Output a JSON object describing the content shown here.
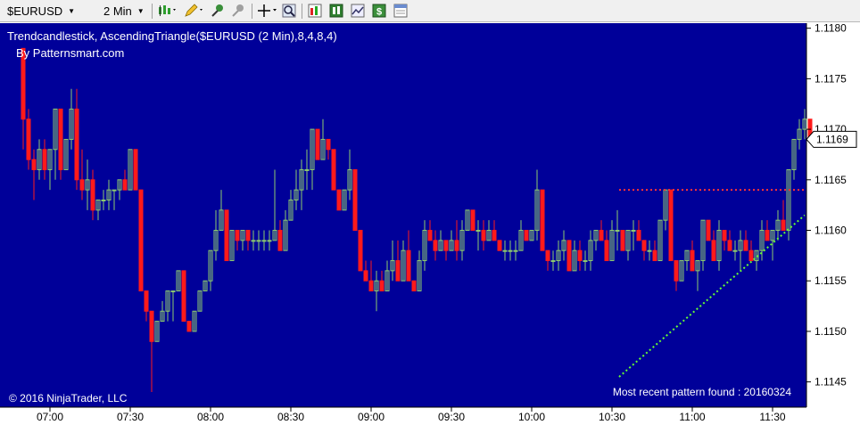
{
  "toolbar": {
    "instrument": "$EURUSD",
    "interval": "2 Min",
    "icons": [
      "chart-style-icon",
      "draw-pencil-icon",
      "pin-icon",
      "pin-gray-icon",
      "crosshair-icon",
      "zoom-icon",
      "indicators-icon",
      "strategies-icon",
      "chart-properties-icon",
      "dollar-icon",
      "data-box-icon"
    ]
  },
  "chart": {
    "indicator_label": "Trendcandlestick,  AscendingTriangle($EURUSD (2 Min),8,4,8,4)",
    "source_label": "By Patternsmart.com",
    "copyright": "© 2016 NinjaTrader, LLC",
    "pattern_status": "Most recent pattern found : 20160324",
    "last_price_label": "1.1169",
    "colors": {
      "background": "#000099",
      "up": "#8ecb6e",
      "down": "#ff1a1a",
      "resistance": "#ff3333",
      "support": "#66ff33"
    }
  },
  "chart_data": {
    "type": "candlestick",
    "x_tick_labels": [
      "07:00",
      "07:30",
      "08:00",
      "08:30",
      "09:00",
      "09:30",
      "10:00",
      "10:30",
      "11:00",
      "11:30"
    ],
    "y_tick_labels": [
      "1.1180",
      "1.1175",
      "1.1170",
      "1.1165",
      "1.1160",
      "1.1155",
      "1.1150",
      "1.1145"
    ],
    "ylim": [
      1.11425,
      1.11805
    ],
    "last_price": 1.1169,
    "resistance_level": 1.1164,
    "support_line": {
      "from": [
        98,
        1.11455
      ],
      "to": [
        146,
        1.11615
      ]
    },
    "candles": [
      [
        1.1178,
        1.1178,
        1.1168,
        1.1171
      ],
      [
        1.1171,
        1.1172,
        1.1166,
        1.1167
      ],
      [
        1.1167,
        1.1168,
        1.1163,
        1.1166
      ],
      [
        1.1166,
        1.1169,
        1.1165,
        1.1168
      ],
      [
        1.1168,
        1.1169,
        1.1165,
        1.1166
      ],
      [
        1.1166,
        1.1168,
        1.1164,
        1.1168
      ],
      [
        1.1168,
        1.1172,
        1.1165,
        1.1172
      ],
      [
        1.1172,
        1.1172,
        1.1165,
        1.1166
      ],
      [
        1.1166,
        1.1169,
        1.1166,
        1.1169
      ],
      [
        1.1169,
        1.1174,
        1.1168,
        1.1172
      ],
      [
        1.1172,
        1.1174,
        1.1164,
        1.1165
      ],
      [
        1.1165,
        1.1168,
        1.1163,
        1.1164
      ],
      [
        1.1164,
        1.1167,
        1.1162,
        1.1165
      ],
      [
        1.1165,
        1.1166,
        1.1161,
        1.1162
      ],
      [
        1.1162,
        1.1163,
        1.1161,
        1.1163
      ],
      [
        1.1163,
        1.1164,
        1.1162,
        1.1163
      ],
      [
        1.1163,
        1.1165,
        1.1162,
        1.1164
      ],
      [
        1.1164,
        1.1164,
        1.1162,
        1.1164
      ],
      [
        1.1164,
        1.1165,
        1.1163,
        1.1165
      ],
      [
        1.1165,
        1.1166,
        1.1164,
        1.1164
      ],
      [
        1.1164,
        1.1168,
        1.1164,
        1.1168
      ],
      [
        1.1168,
        1.1168,
        1.1164,
        1.1164
      ],
      [
        1.1164,
        1.1164,
        1.1155,
        1.1154
      ],
      [
        1.1154,
        1.1154,
        1.1151,
        1.1152
      ],
      [
        1.1152,
        1.1152,
        1.1144,
        1.1149
      ],
      [
        1.1149,
        1.1151,
        1.1149,
        1.1151
      ],
      [
        1.1151,
        1.1153,
        1.1151,
        1.1152
      ],
      [
        1.1152,
        1.1154,
        1.1151,
        1.1154
      ],
      [
        1.1154,
        1.1154,
        1.1151,
        1.1154
      ],
      [
        1.1154,
        1.1156,
        1.1154,
        1.1156
      ],
      [
        1.1156,
        1.1156,
        1.1151,
        1.1151
      ],
      [
        1.1151,
        1.1151,
        1.115,
        1.115
      ],
      [
        1.115,
        1.1152,
        1.115,
        1.1152
      ],
      [
        1.1152,
        1.1154,
        1.1152,
        1.1154
      ],
      [
        1.1154,
        1.1155,
        1.1154,
        1.1155
      ],
      [
        1.1155,
        1.1158,
        1.1154,
        1.1158
      ],
      [
        1.1158,
        1.1162,
        1.1157,
        1.116
      ],
      [
        1.116,
        1.1164,
        1.116,
        1.1162
      ],
      [
        1.1162,
        1.1162,
        1.1157,
        1.1157
      ],
      [
        1.1157,
        1.116,
        1.1157,
        1.116
      ],
      [
        1.116,
        1.116,
        1.1158,
        1.1159
      ],
      [
        1.1159,
        1.116,
        1.1158,
        1.116
      ],
      [
        1.116,
        1.116,
        1.1158,
        1.1159
      ],
      [
        1.1159,
        1.116,
        1.1158,
        1.1159
      ],
      [
        1.1159,
        1.116,
        1.1158,
        1.1159
      ],
      [
        1.1159,
        1.116,
        1.1158,
        1.1159
      ],
      [
        1.1159,
        1.116,
        1.1158,
        1.1159
      ],
      [
        1.1159,
        1.1166,
        1.1159,
        1.116
      ],
      [
        1.116,
        1.1161,
        1.1158,
        1.1158
      ],
      [
        1.1158,
        1.1162,
        1.1158,
        1.1161
      ],
      [
        1.1161,
        1.1164,
        1.1161,
        1.1163
      ],
      [
        1.1163,
        1.1166,
        1.1162,
        1.1164
      ],
      [
        1.1164,
        1.1167,
        1.1162,
        1.1166
      ],
      [
        1.1166,
        1.1168,
        1.1164,
        1.1166
      ],
      [
        1.1166,
        1.117,
        1.1164,
        1.117
      ],
      [
        1.117,
        1.117,
        1.1167,
        1.1167
      ],
      [
        1.1167,
        1.1171,
        1.1167,
        1.1169
      ],
      [
        1.1169,
        1.1169,
        1.1167,
        1.1168
      ],
      [
        1.1168,
        1.1168,
        1.1164,
        1.1164
      ],
      [
        1.1164,
        1.1164,
        1.1162,
        1.1162
      ],
      [
        1.1162,
        1.1164,
        1.1162,
        1.1164
      ],
      [
        1.1164,
        1.1168,
        1.1163,
        1.1166
      ],
      [
        1.1166,
        1.1166,
        1.116,
        1.116
      ],
      [
        1.116,
        1.116,
        1.1156,
        1.1156
      ],
      [
        1.1156,
        1.1157,
        1.1155,
        1.1155
      ],
      [
        1.1155,
        1.1157,
        1.1154,
        1.1154
      ],
      [
        1.1154,
        1.1156,
        1.1152,
        1.1155
      ],
      [
        1.1155,
        1.1156,
        1.1154,
        1.1154
      ],
      [
        1.1154,
        1.1157,
        1.1154,
        1.1156
      ],
      [
        1.1156,
        1.1159,
        1.1155,
        1.1157
      ],
      [
        1.1157,
        1.1159,
        1.1155,
        1.1155
      ],
      [
        1.1155,
        1.1159,
        1.1155,
        1.1158
      ],
      [
        1.1158,
        1.116,
        1.1155,
        1.1155
      ],
      [
        1.1155,
        1.1155,
        1.1154,
        1.1154
      ],
      [
        1.1154,
        1.1158,
        1.1154,
        1.1157
      ],
      [
        1.1157,
        1.1161,
        1.1156,
        1.116
      ],
      [
        1.116,
        1.1161,
        1.1159,
        1.1159
      ],
      [
        1.1159,
        1.116,
        1.1157,
        1.1158
      ],
      [
        1.1158,
        1.116,
        1.1158,
        1.1159
      ],
      [
        1.1159,
        1.1159,
        1.1157,
        1.1158
      ],
      [
        1.1158,
        1.116,
        1.1158,
        1.1159
      ],
      [
        1.1159,
        1.1161,
        1.1157,
        1.1158
      ],
      [
        1.1158,
        1.1161,
        1.1157,
        1.116
      ],
      [
        1.116,
        1.1162,
        1.116,
        1.1162
      ],
      [
        1.1162,
        1.1162,
        1.116,
        1.116
      ],
      [
        1.116,
        1.1161,
        1.1158,
        1.116
      ],
      [
        1.116,
        1.1161,
        1.1158,
        1.1159
      ],
      [
        1.1159,
        1.1161,
        1.1159,
        1.116
      ],
      [
        1.116,
        1.1161,
        1.1159,
        1.1159
      ],
      [
        1.1159,
        1.1159,
        1.1158,
        1.1158
      ],
      [
        1.1158,
        1.1159,
        1.1157,
        1.1158
      ],
      [
        1.1158,
        1.1159,
        1.1157,
        1.1158
      ],
      [
        1.1158,
        1.1159,
        1.1157,
        1.1158
      ],
      [
        1.1158,
        1.1161,
        1.1158,
        1.116
      ],
      [
        1.116,
        1.116,
        1.1159,
        1.1159
      ],
      [
        1.1159,
        1.116,
        1.1159,
        1.116
      ],
      [
        1.116,
        1.1166,
        1.1159,
        1.1164
      ],
      [
        1.1164,
        1.1164,
        1.1158,
        1.1158
      ],
      [
        1.1158,
        1.1158,
        1.1156,
        1.1157
      ],
      [
        1.1157,
        1.1158,
        1.1156,
        1.1157
      ],
      [
        1.1157,
        1.1159,
        1.1156,
        1.1158
      ],
      [
        1.1158,
        1.116,
        1.1157,
        1.1159
      ],
      [
        1.1159,
        1.1159,
        1.1156,
        1.1156
      ],
      [
        1.1156,
        1.1159,
        1.1156,
        1.1158
      ],
      [
        1.1158,
        1.1159,
        1.1156,
        1.1157
      ],
      [
        1.1157,
        1.1158,
        1.1156,
        1.1157
      ],
      [
        1.1157,
        1.116,
        1.1156,
        1.1159
      ],
      [
        1.1159,
        1.116,
        1.1158,
        1.116
      ],
      [
        1.116,
        1.1161,
        1.1159,
        1.1159
      ],
      [
        1.1159,
        1.116,
        1.1157,
        1.1157
      ],
      [
        1.1157,
        1.1161,
        1.1157,
        1.116
      ],
      [
        1.116,
        1.1162,
        1.1158,
        1.116
      ],
      [
        1.116,
        1.116,
        1.1158,
        1.1158
      ],
      [
        1.1158,
        1.116,
        1.1157,
        1.116
      ],
      [
        1.116,
        1.1161,
        1.1158,
        1.116
      ],
      [
        1.116,
        1.1161,
        1.1159,
        1.1159
      ],
      [
        1.1159,
        1.1159,
        1.1157,
        1.1158
      ],
      [
        1.1158,
        1.1159,
        1.1157,
        1.1158
      ],
      [
        1.1158,
        1.1159,
        1.1157,
        1.1157
      ],
      [
        1.1157,
        1.1161,
        1.1157,
        1.1161
      ],
      [
        1.1161,
        1.1164,
        1.116,
        1.1164
      ],
      [
        1.1164,
        1.1164,
        1.1157,
        1.1157
      ],
      [
        1.1157,
        1.1157,
        1.1154,
        1.1155
      ],
      [
        1.1155,
        1.1157,
        1.1155,
        1.1157
      ],
      [
        1.1157,
        1.1158,
        1.1156,
        1.1158
      ],
      [
        1.1158,
        1.1159,
        1.1156,
        1.1156
      ],
      [
        1.1156,
        1.1157,
        1.1154,
        1.1157
      ],
      [
        1.1157,
        1.1161,
        1.1156,
        1.1161
      ],
      [
        1.1161,
        1.1161,
        1.1159,
        1.1159
      ],
      [
        1.1159,
        1.116,
        1.1157,
        1.1157
      ],
      [
        1.1157,
        1.1161,
        1.1156,
        1.116
      ],
      [
        1.116,
        1.116,
        1.1158,
        1.1159
      ],
      [
        1.1159,
        1.116,
        1.1158,
        1.1158
      ],
      [
        1.1158,
        1.1159,
        1.1157,
        1.1158
      ],
      [
        1.1158,
        1.116,
        1.1156,
        1.1159
      ],
      [
        1.1159,
        1.116,
        1.1158,
        1.1158
      ],
      [
        1.1158,
        1.1159,
        1.1157,
        1.1157
      ],
      [
        1.1157,
        1.1158,
        1.1156,
        1.1158
      ],
      [
        1.1158,
        1.1161,
        1.1157,
        1.116
      ],
      [
        1.116,
        1.1161,
        1.1159,
        1.1159
      ],
      [
        1.1159,
        1.116,
        1.1157,
        1.116
      ],
      [
        1.116,
        1.1162,
        1.1159,
        1.1161
      ],
      [
        1.1161,
        1.1163,
        1.116,
        1.116
      ],
      [
        1.116,
        1.1166,
        1.1159,
        1.1166
      ],
      [
        1.1166,
        1.1169,
        1.1165,
        1.1169
      ],
      [
        1.1169,
        1.1171,
        1.1168,
        1.117
      ],
      [
        1.117,
        1.1172,
        1.1169,
        1.1171
      ],
      [
        1.1171,
        1.1171,
        1.1169,
        1.1169
      ]
    ]
  }
}
